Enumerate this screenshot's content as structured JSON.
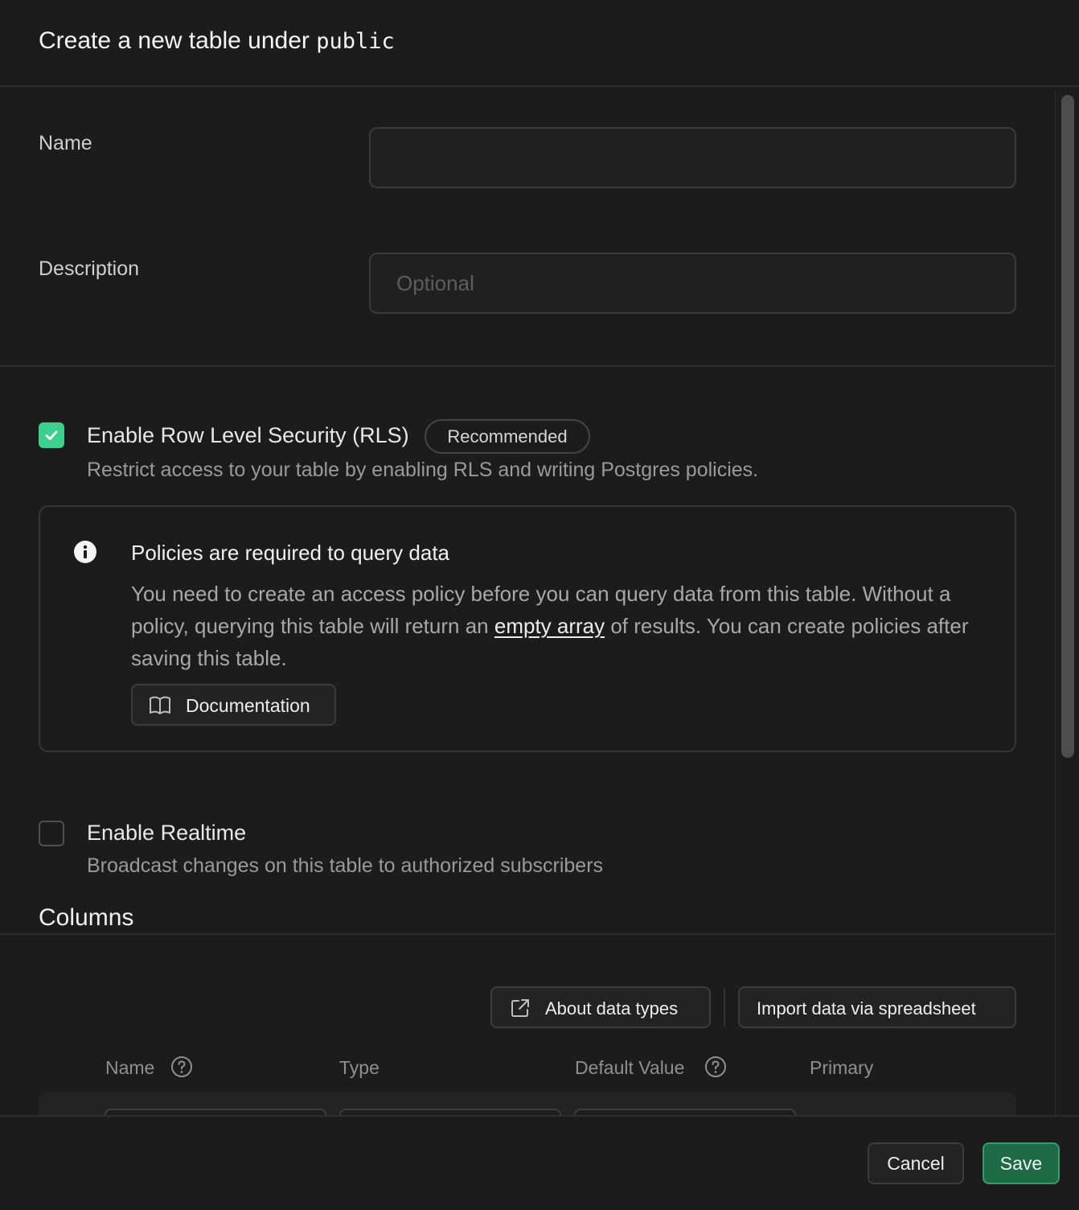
{
  "header": {
    "title_prefix": "Create a new table under",
    "schema": "public"
  },
  "form": {
    "name_label": "Name",
    "name_value": "",
    "description_label": "Description",
    "description_placeholder": "Optional"
  },
  "rls": {
    "checked": true,
    "title": "Enable Row Level Security (RLS)",
    "badge": "Recommended",
    "description": "Restrict access to your table by enabling RLS and writing Postgres policies."
  },
  "alert": {
    "icon": "info-icon",
    "title": "Policies are required to query data",
    "body_before": "You need to create an access policy before you can query data from this table. Without a policy, querying this table will return an ",
    "body_link": "empty array",
    "body_after": " of results. You can create policies after saving this table.",
    "doc_button": "Documentation"
  },
  "realtime": {
    "checked": false,
    "title": "Enable Realtime",
    "description": "Broadcast changes on this table to authorized subscribers"
  },
  "columns": {
    "title": "Columns",
    "about_button": "About data types",
    "import_button": "Import data via spreadsheet",
    "headers": [
      "Name",
      "Type",
      "Default Value",
      "Primary"
    ]
  },
  "footer": {
    "cancel": "Cancel",
    "save": "Save"
  },
  "colors": {
    "accent": "#3ecf8e",
    "save_bg": "#1f6b45",
    "background": "#1c1c1c"
  }
}
